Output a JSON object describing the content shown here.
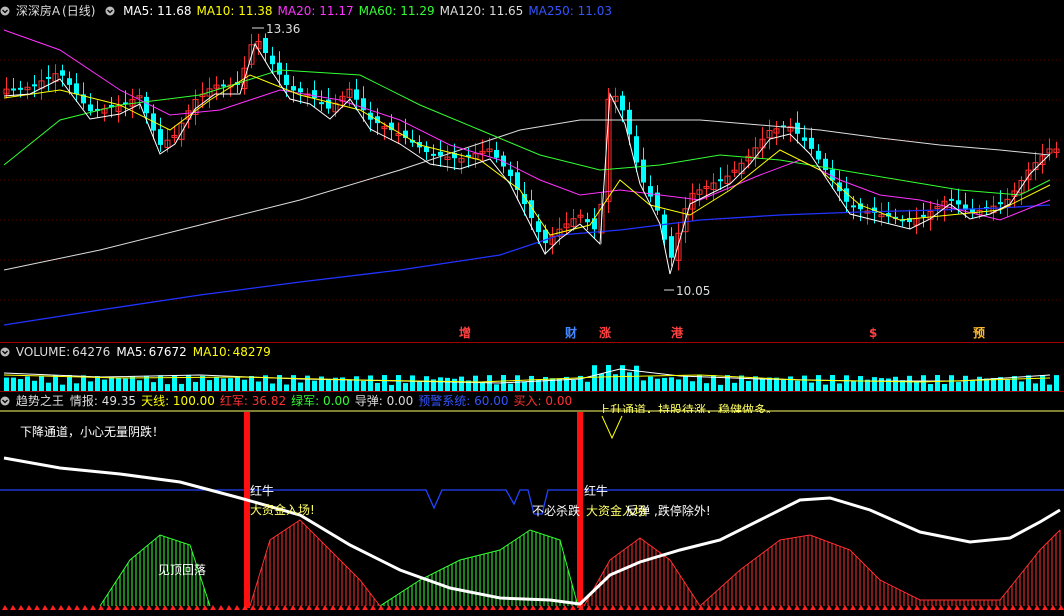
{
  "main": {
    "stock_name": "深深房A",
    "period": "(日线)",
    "ma": [
      {
        "label": "MA5:",
        "value": "11.68",
        "color": "#ffffff"
      },
      {
        "label": "MA10:",
        "value": "11.38",
        "color": "#ffff00"
      },
      {
        "label": "MA20:",
        "value": "11.17",
        "color": "#ff33ff"
      },
      {
        "label": "MA60:",
        "value": "11.29",
        "color": "#33ff33"
      },
      {
        "label": "MA120:",
        "value": "11.65",
        "color": "#dddddd"
      },
      {
        "label": "MA250:",
        "value": "11.03",
        "color": "#3355ff"
      }
    ],
    "high_label": "13.36",
    "low_label": "10.05",
    "markers": [
      "增",
      "财",
      "涨",
      "港",
      "$",
      "预"
    ]
  },
  "volume": {
    "title": "VOLUME:",
    "value": "64276",
    "ma5_label": "MA5:",
    "ma5": "67672",
    "ma10_label": "MA10:",
    "ma10": "48279"
  },
  "indicator": {
    "name": "趋势之王",
    "fields": [
      {
        "label": "情报:",
        "value": "49.35",
        "color": "#dddddd"
      },
      {
        "label": "天线:",
        "value": "100.00",
        "color": "#ffff00"
      },
      {
        "label": "红军:",
        "value": "36.82",
        "color": "#ff3333"
      },
      {
        "label": "绿军:",
        "value": "0.00",
        "color": "#33ff33"
      },
      {
        "label": "导弹:",
        "value": "0.00",
        "color": "#dddddd"
      },
      {
        "label": "预警系统:",
        "value": "60.00",
        "color": "#3355ff"
      },
      {
        "label": "买入:",
        "value": "0.00",
        "color": "#ff3333"
      }
    ],
    "notes": {
      "downtrend": "下降通道，小心无量阴跌！",
      "top_note": "上升通道，持股待涨，稳健做多。",
      "red_bull_1": "红牛",
      "big_money_1": "大资金入场!",
      "red_bull_2": "红牛",
      "big_money_2": "大资金入场",
      "no_panic": "不必杀跌",
      "rebound": "反弹",
      "limit_up": ",跌停除外!",
      "top_seen": "见顶回落"
    }
  }
}
